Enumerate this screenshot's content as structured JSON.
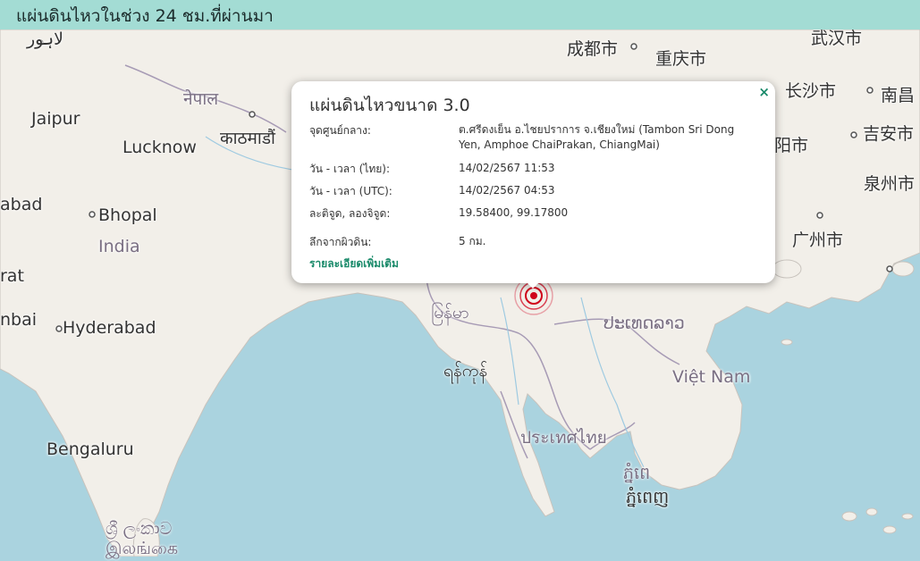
{
  "header": {
    "title": "แผ่นดินไหวในช่วง 24 ชม.ที่ผ่านมา"
  },
  "popup": {
    "title": "แผ่นดินไหวขนาด 3.0",
    "close_icon": "×",
    "rows": [
      {
        "key": "จุดศูนย์กลาง:",
        "value": "ต.ศรีดงเย็น อ.ไชยปราการ จ.เชียงใหม่ (Tambon Sri Dong Yen, Amphoe ChaiPrakan, ChiangMai)"
      },
      {
        "key": "วัน - เวลา (ไทย):",
        "value": "14/02/2567 11:53"
      },
      {
        "key": "วัน - เวลา (UTC):",
        "value": "14/02/2567 04:53"
      },
      {
        "key": "ละติจูด, ลองจิจูด:",
        "value": "19.58400, 99.17800"
      },
      {
        "key": "ลึกจากผิวดิน:",
        "value": "5 กม."
      }
    ],
    "more_link": "รายละเอียดเพิ่มเติม"
  },
  "map": {
    "labels": {
      "lahore": "لاہور",
      "nepal": "नेपाल",
      "jaipur": "Jaipur",
      "lucknow": "Lucknow",
      "kathmandu": "काठमाडौं",
      "abad": "abad",
      "bhopal": "Bhopal",
      "india": "India",
      "rat": "rat",
      "nbai": "nbai",
      "hyderabad": "Hyderabad",
      "bengaluru": "Bengaluru",
      "srilanka1": "ශ්‍රී ලංකාව",
      "srilanka2": "இலங்கை",
      "chengdu": "成都市",
      "chongqing": "重庆市",
      "wuhan": "武汉市",
      "changsha": "长沙市",
      "nanchang": "南昌",
      "hengyang": "阳市",
      "jian": "吉安市",
      "quanzhou": "泉州市",
      "guangzhou": "广州市",
      "myanmar": "မြန်မာ",
      "yangon": "ရန်ကုန်",
      "laos": "ປະເທດລາວ",
      "vietnam": "Việt Nam",
      "thailand": "ประเทศไทย",
      "cambodia1": "ភ្នំពេ",
      "cambodia2": "ភ្នំពេញ"
    },
    "colors": {
      "water": "#aad3df",
      "land": "#f2efe9",
      "border": "#a79bb5",
      "quake": "#d0021b"
    }
  }
}
